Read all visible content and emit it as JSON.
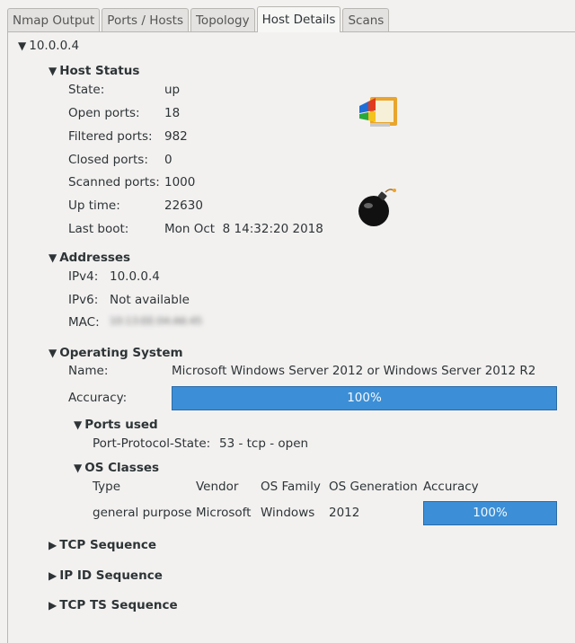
{
  "tabs": [
    "Nmap Output",
    "Ports / Hosts",
    "Topology",
    "Host Details",
    "Scans"
  ],
  "host": "10.0.0.4",
  "status": {
    "title": "Host Status",
    "rows": [
      {
        "label": "State:",
        "value": "up"
      },
      {
        "label": "Open ports:",
        "value": "18"
      },
      {
        "label": "Filtered ports:",
        "value": "982"
      },
      {
        "label": "Closed ports:",
        "value": "0"
      },
      {
        "label": "Scanned ports:",
        "value": "1000"
      },
      {
        "label": "Up time:",
        "value": "22630"
      },
      {
        "label": "Last boot:",
        "value": "Mon Oct  8 14:32:20 2018"
      }
    ]
  },
  "addresses": {
    "title": "Addresses",
    "rows": [
      {
        "label": "IPv4:",
        "value": "10.0.0.4"
      },
      {
        "label": "IPv6:",
        "value": "Not available"
      },
      {
        "label": "MAC:",
        "value": "10:13:EE:04:A6:45"
      }
    ]
  },
  "os": {
    "title": "Operating System",
    "name_label": "Name:",
    "name_value": "Microsoft Windows Server 2012 or Windows Server 2012 R2",
    "accuracy_label": "Accuracy:",
    "accuracy_value": "100%",
    "accuracy_fraction": 1.0,
    "ports_used": {
      "title": "Ports used",
      "label": "Port-Protocol-State:",
      "value": "53 - tcp - open"
    },
    "classes": {
      "title": "OS Classes",
      "headers": [
        "Type",
        "Vendor",
        "OS Family",
        "OS Generation",
        "Accuracy"
      ],
      "row": [
        "general purpose",
        "Microsoft",
        "Windows",
        "2012",
        "100%"
      ]
    }
  },
  "collapsed": [
    "TCP Sequence",
    "IP ID Sequence",
    "TCP TS Sequence"
  ],
  "colors": {
    "accent": "#3c8fd6"
  }
}
